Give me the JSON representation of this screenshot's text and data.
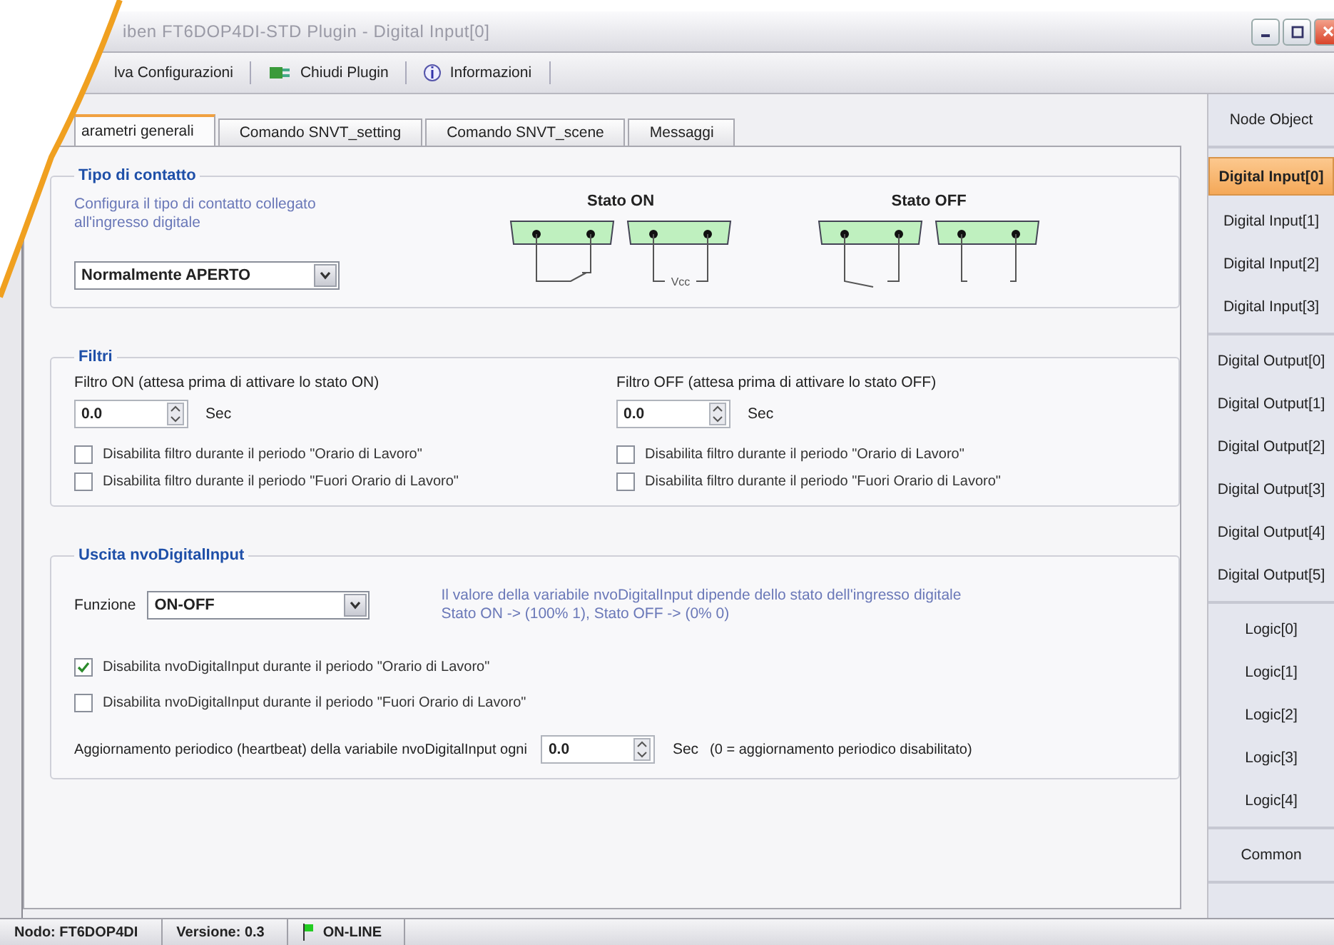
{
  "window": {
    "title": "iben FT6DOP4DI-STD Plugin - Digital Input[0]"
  },
  "toolbar": [
    {
      "label": "lva Configurazioni"
    },
    {
      "label": "Chiudi Plugin"
    },
    {
      "label": "Informazioni"
    }
  ],
  "tabs": [
    {
      "label": "arametri generali",
      "selected": true
    },
    {
      "label": "Comando SNVT_setting",
      "selected": false
    },
    {
      "label": "Comando SNVT_scene",
      "selected": false
    },
    {
      "label": "Messaggi",
      "selected": false
    }
  ],
  "contact": {
    "title": "Tipo di contatto",
    "description": "Configura il tipo di contatto collegato all'ingresso digitale",
    "select": "Normalmente APERTO",
    "states": [
      {
        "title": "Stato ON",
        "diagrams": [
          {
            "kind": "switch_closed"
          },
          {
            "kind": "vcc",
            "label": "Vcc"
          }
        ]
      },
      {
        "title": "Stato OFF",
        "diagrams": [
          {
            "kind": "switch_open"
          },
          {
            "kind": "open"
          }
        ]
      }
    ]
  },
  "filters": {
    "title": "Filtri",
    "columns": [
      {
        "label": "Filtro ON  (attesa prima di attivare lo stato ON)",
        "value": "0.0",
        "unit": "Sec",
        "checkboxes": [
          {
            "label": "Disabilita filtro durante il periodo \"Orario di Lavoro\"",
            "checked": false
          },
          {
            "label": "Disabilita filtro durante il periodo \"Fuori Orario di Lavoro\"",
            "checked": false
          }
        ]
      },
      {
        "label": "Filtro OFF  (attesa prima di attivare lo stato OFF)",
        "value": "0.0",
        "unit": "Sec",
        "checkboxes": [
          {
            "label": "Disabilita filtro durante il periodo \"Orario di Lavoro\"",
            "checked": false
          },
          {
            "label": "Disabilita filtro durante il periodo \"Fuori Orario di Lavoro\"",
            "checked": false
          }
        ]
      }
    ]
  },
  "output": {
    "title": "Uscita nvoDigitalInput",
    "function_label": "Funzione",
    "select": "ON-OFF",
    "info": [
      "Il valore della variabile nvoDigitalInput dipende dello stato dell'ingresso digitale",
      "Stato ON -> (100% 1), Stato OFF -> (0% 0)"
    ],
    "checkboxes": [
      {
        "label": "Disabilita nvoDigitalInput durante il periodo \"Orario di Lavoro\"",
        "checked": true
      },
      {
        "label": "Disabilita nvoDigitalInput durante il periodo \"Fuori Orario di Lavoro\"",
        "checked": false
      }
    ],
    "heartbeat": {
      "label": "Aggiornamento periodico (heartbeat) della variabile nvoDigitalInput ogni",
      "value": "0.0",
      "unit": "Sec",
      "note": "(0 = aggiornamento periodico disabilitato)"
    }
  },
  "sidebar": {
    "groups": [
      [
        {
          "label": "Node Object",
          "selected": false
        }
      ],
      [
        {
          "label": "Digital Input[0]",
          "selected": true
        },
        {
          "label": "Digital Input[1]",
          "selected": false
        },
        {
          "label": "Digital Input[2]",
          "selected": false
        },
        {
          "label": "Digital Input[3]",
          "selected": false
        }
      ],
      [
        {
          "label": "Digital Output[0]",
          "selected": false
        },
        {
          "label": "Digital Output[1]",
          "selected": false
        },
        {
          "label": "Digital Output[2]",
          "selected": false
        },
        {
          "label": "Digital Output[3]",
          "selected": false
        },
        {
          "label": "Digital Output[4]",
          "selected": false
        },
        {
          "label": "Digital Output[5]",
          "selected": false
        }
      ],
      [
        {
          "label": "Logic[0]",
          "selected": false
        },
        {
          "label": "Logic[1]",
          "selected": false
        },
        {
          "label": "Logic[2]",
          "selected": false
        },
        {
          "label": "Logic[3]",
          "selected": false
        },
        {
          "label": "Logic[4]",
          "selected": false
        }
      ],
      [
        {
          "label": "Common",
          "selected": false
        }
      ]
    ]
  },
  "status_bar": [
    {
      "text": "Nodo: FT6DOP4DI"
    },
    {
      "text": "Versione: 0.3"
    },
    {
      "text": "ON-LINE"
    }
  ]
}
